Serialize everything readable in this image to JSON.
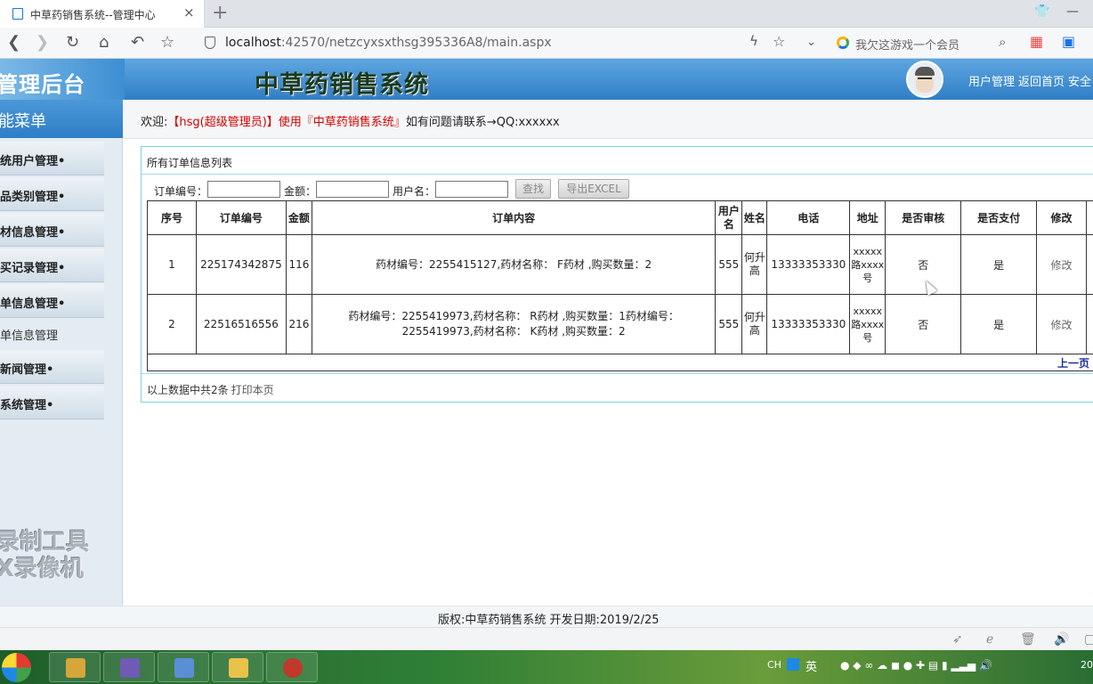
{
  "browser": {
    "tab_title": "中草药销售系统--管理中心",
    "tab_close": "×",
    "new_tab": "+",
    "url_host": "localhost",
    "url_rest": ":42570/netzcyxsxthsg395336A8/main.aspx",
    "search_hint": "我欠这游戏一个会员"
  },
  "header": {
    "brand": "管理后台",
    "system_title": "中草药销售系统",
    "links": [
      "用户管理",
      "返回首页",
      "安全"
    ]
  },
  "sidebar": {
    "title": "能菜单",
    "items": [
      {
        "label": "统用户管理•"
      },
      {
        "label": "品类别管理•"
      },
      {
        "label": "材信息管理•"
      },
      {
        "label": "买记录管理•"
      },
      {
        "label": "单信息管理•"
      },
      {
        "label": "单信息管理"
      },
      {
        "label": "新闻管理•"
      },
      {
        "label": "系统管理•"
      }
    ],
    "watermark_line1": "录制工具",
    "watermark_line2": "X录像机"
  },
  "welcome": {
    "prefix": "欢迎:",
    "user": "【hsg(超级管理员)】使用『中草药销售系统』",
    "suffix": "如有问题请联系→QQ:xxxxxx"
  },
  "orders": {
    "panel_title": "所有订单信息列表",
    "search": {
      "order_no_label": "订单编号：",
      "amount_label": "金额：",
      "username_label": "用户名：",
      "order_no_value": "",
      "amount_value": "",
      "username_value": "",
      "find_button": "查找",
      "export_button": "导出EXCEL"
    },
    "columns": [
      "序号",
      "订单编号",
      "金额",
      "订单内容",
      "用户名",
      "姓名",
      "电话",
      "地址",
      "是否审核",
      "是否支付",
      "修改"
    ],
    "rows": [
      {
        "seq": "1",
        "order_no": "225174342875",
        "amount": "116",
        "content": "药材编号：2255415127,药材名称： F药材 ,购买数量：2",
        "username": "555",
        "name": "何升高",
        "phone": "13333353330",
        "address": "xxxxx路xxxx号",
        "audited": "否",
        "paid": "是",
        "edit": "修改"
      },
      {
        "seq": "2",
        "order_no": "22516516556",
        "amount": "216",
        "content": "药材编号：2255419973,药材名称： R药材 ,购买数量：1药材编号：2255419973,药材名称： K药材 ,购买数量：2",
        "username": "555",
        "name": "何升高",
        "phone": "13333353330",
        "address": "xxxxx路xxxx号",
        "audited": "否",
        "paid": "是",
        "edit": "修改"
      }
    ],
    "pager_prev": "上一页",
    "summary": "以上数据中共2条",
    "print_link": "打印本页"
  },
  "footer": {
    "copyright": "版权:中草药销售系统 开发日期:2019/2/25"
  },
  "taskbar": {
    "ime_lang": "英",
    "ime_mode": "CH",
    "clock": "20"
  }
}
